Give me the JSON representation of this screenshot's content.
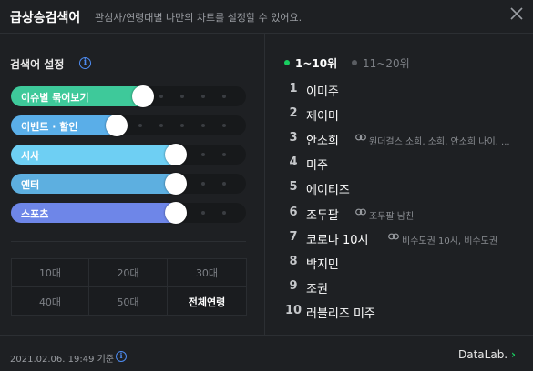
{
  "header": {
    "title": "급상승검색어",
    "subtitle": "관심사/연령대별 나만의 차트를 설정할 수 있어요."
  },
  "settings": {
    "title": "검색어 설정",
    "info_icon": "info-icon",
    "rows": [
      {
        "label": "이슈별 묶어보기",
        "color": "#3ec99a",
        "level_percent": 60
      },
      {
        "label": "이벤트 · 할인",
        "color": "#5aaee8",
        "level_percent": 49
      },
      {
        "label": "시사",
        "color": "#6ecff3",
        "level_percent": 74
      },
      {
        "label": "엔터",
        "color": "#5dafe0",
        "level_percent": 74
      },
      {
        "label": "스포츠",
        "color": "#6e86e8",
        "level_percent": 74
      }
    ]
  },
  "age_groups": [
    {
      "label": "10대",
      "selected": false
    },
    {
      "label": "20대",
      "selected": false
    },
    {
      "label": "30대",
      "selected": false
    },
    {
      "label": "40대",
      "selected": false
    },
    {
      "label": "50대",
      "selected": false
    },
    {
      "label": "전체연령",
      "selected": true
    }
  ],
  "tabs": [
    {
      "label": "1~10위",
      "active": true,
      "bullet_color": "#19ce60"
    },
    {
      "label": "11~20위",
      "active": false,
      "bullet_color": "#5a5d62"
    }
  ],
  "rankings": [
    {
      "rank": "1",
      "keyword": "이미주",
      "related": ""
    },
    {
      "rank": "2",
      "keyword": "제이미",
      "related": ""
    },
    {
      "rank": "3",
      "keyword": "안소희",
      "related": "원더걸스 소희, 소희, 안소희 나이, ..."
    },
    {
      "rank": "4",
      "keyword": "미주",
      "related": ""
    },
    {
      "rank": "5",
      "keyword": "에이티즈",
      "related": ""
    },
    {
      "rank": "6",
      "keyword": "조두팔",
      "related": "조두팔 남친"
    },
    {
      "rank": "7",
      "keyword": "코로나 10시",
      "related": "비수도권 10시, 비수도권"
    },
    {
      "rank": "8",
      "keyword": "박지민",
      "related": ""
    },
    {
      "rank": "9",
      "keyword": "조권",
      "related": ""
    },
    {
      "rank": "10",
      "keyword": "러블리즈 미주",
      "related": ""
    }
  ],
  "footer": {
    "date": "2021.02.06. 19:49 기준",
    "brand": "DataLab.",
    "brand_arrow": "›"
  }
}
